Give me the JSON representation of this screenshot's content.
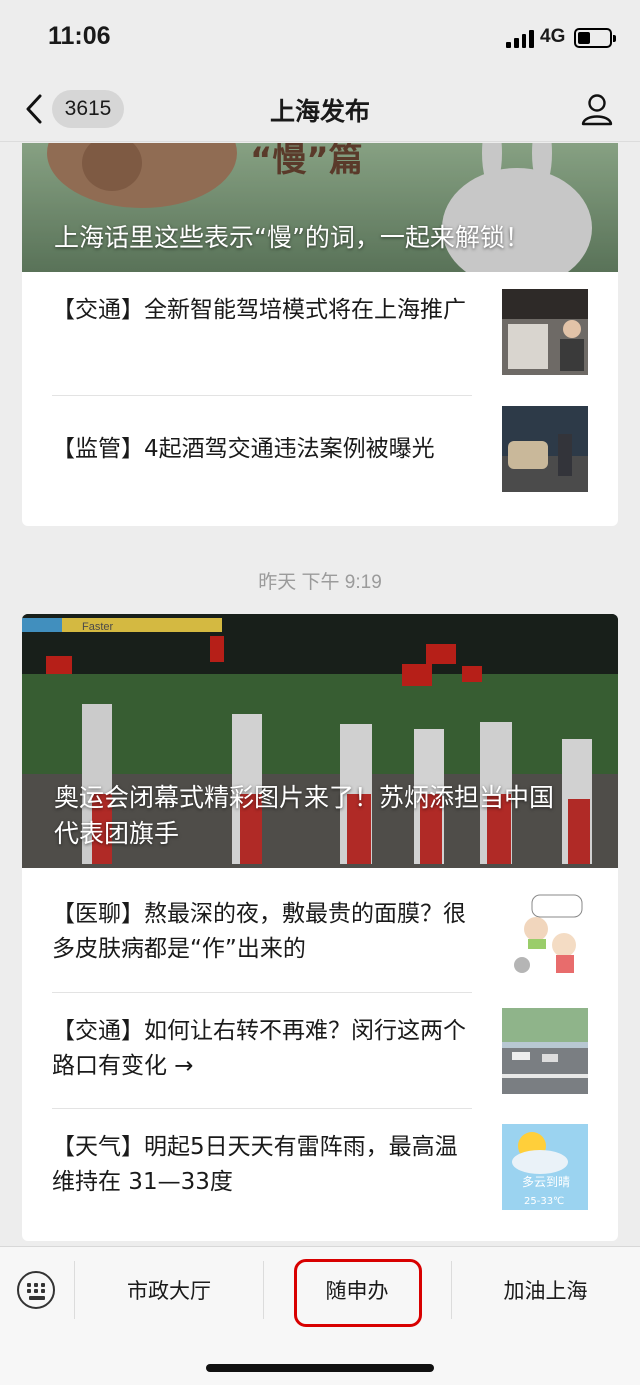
{
  "status_bar": {
    "time": "11:06",
    "network": "4G",
    "battery_level": 0.4
  },
  "nav": {
    "badge_count": "3615",
    "title": "上海发布"
  },
  "feed": {
    "card1": {
      "hero_caption": "上海话里这些表示“慢”的词，一起来解锁！",
      "hero_art_text": "“慢”篇",
      "items": [
        {
          "text": "【交通】全新智能驾培模式将在上海推广"
        },
        {
          "text": "【监管】4起酒驾交通违法案例被曝光"
        }
      ]
    },
    "timestamp": "昨天 下午 9:19",
    "card2": {
      "hero_caption": "奥运会闭幕式精彩图片来了！苏炳添担当中国代表团旗手",
      "hero_banner_text": "Faster",
      "items": [
        {
          "text": "【医聊】熬最深的夜，敷最贵的面膜？很多皮肤病都是“作”出来的"
        },
        {
          "text": "【交通】如何让右转不再难？闵行这两个路口有变化 →"
        },
        {
          "text": "【天气】明起5日天天有雷阵雨，最高温维持在 31—33度",
          "thumb_text_1": "多云到晴",
          "thumb_text_2": "25-33℃"
        }
      ]
    }
  },
  "menu": {
    "items": [
      "市政大厅",
      "随申办",
      "加油上海"
    ]
  },
  "colors": {
    "background": "#ededed",
    "highlight": "#d80000"
  }
}
